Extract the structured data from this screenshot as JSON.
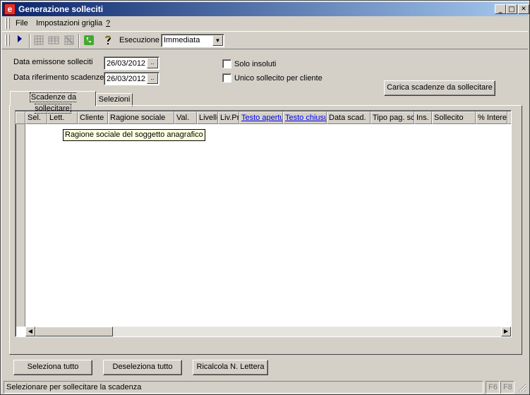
{
  "window": {
    "title": "Generazione solleciti",
    "app_icon": "e",
    "minimize": "_",
    "maximize": "□",
    "close": "✕"
  },
  "menu": {
    "file": "File",
    "impostazioni": "Impostazioni griglia",
    "help": "?"
  },
  "toolbar": {
    "execution_label": "Esecuzione",
    "execution_value": "Immediata"
  },
  "form": {
    "data_emissione_label": "Data emissone solleciti",
    "data_emissione_value": "26/03/2012",
    "data_riferimento_label": "Data riferimento scadenze",
    "data_riferimento_value": "26/03/2012",
    "browse": "..",
    "solo_insoluti": "Solo insoluti",
    "unico_sollecito": "Unico sollecito per cliente",
    "carica_button": "Carica scadenze da sollecitare"
  },
  "tabs": {
    "scadenze": "Scadenze da sollecitare",
    "selezioni": "Selezioni"
  },
  "grid": {
    "columns": [
      "Sel.",
      "Lett.",
      "Cliente",
      "Ragione sociale",
      "Val.",
      "Livello",
      "Liv.Pr",
      "Testo apertura",
      "Testo chiusura",
      "Data scad.",
      "Tipo pag. sc",
      "Ins.",
      "Sollecito",
      "% Interessi",
      ""
    ],
    "tooltip": "Ragione sociale del soggetto anagrafico"
  },
  "buttons": {
    "seleziona": "Seleziona tutto",
    "deseleziona": "Deseleziona tutto",
    "ricalcola": "Ricalcola N. Lettera"
  },
  "status": {
    "message": "Selezionare per sollecitare la scadenza",
    "f6": "F6",
    "f8": "F8"
  }
}
